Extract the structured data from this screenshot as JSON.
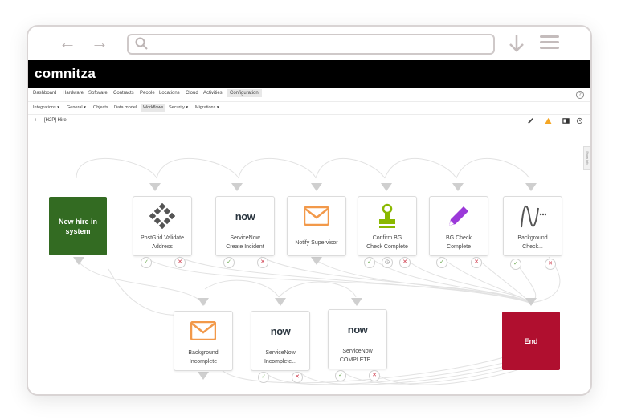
{
  "browser": {
    "back": "←",
    "forward": "→"
  },
  "brand": {
    "logo": "comnitza"
  },
  "menubar": [
    "Dashboard",
    "Hardware",
    "Software",
    "Contracts",
    "People",
    "Locations",
    "Cloud",
    "Activities",
    "Configuration"
  ],
  "submenu": [
    "Integrations ▾",
    "General ▾",
    "Objects",
    "Data model",
    "Workflows",
    "Security ▾",
    "Migrations ▾"
  ],
  "breadcrumb": {
    "back": "‹",
    "title": "[H2P] Hire"
  },
  "side_tab": "Show info",
  "nodes": {
    "start": "New hire in system",
    "postgrid": [
      "PostGrid Validate",
      "Address"
    ],
    "sn_incident": [
      "ServiceNow",
      "Create Incident"
    ],
    "notify": [
      "Notify Supervisor"
    ],
    "confirm_bg": [
      "Confirm BG",
      "Check Complete"
    ],
    "bg_complete": [
      "BG Check",
      "Complete"
    ],
    "bg_check": [
      "Background",
      "Check..."
    ],
    "bg_incomplete": [
      "Background",
      "Incomplete"
    ],
    "sn_incomplete": [
      "ServiceNow",
      "Incomplete..."
    ],
    "sn_complete": [
      "ServiceNow",
      "COMPLETE..."
    ],
    "end": "End"
  },
  "icons": {
    "now": "now",
    "ok": "✓",
    "no": "✕",
    "wait": "◷"
  },
  "colors": {
    "start": "#336b22",
    "end": "#b00f2f",
    "mail": "#f2994a",
    "stamp": "#8ab800",
    "pencil": "#9b39d9"
  }
}
